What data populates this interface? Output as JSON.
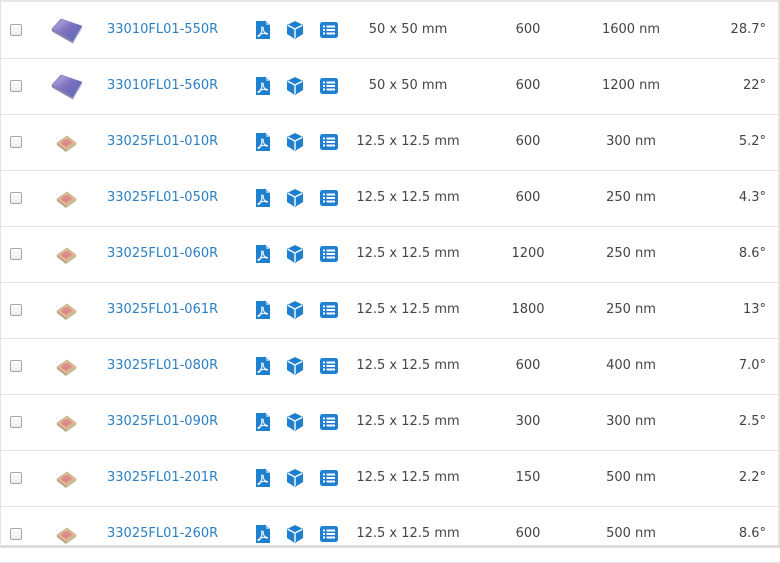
{
  "table": {
    "rows": [
      {
        "part": "33010FL01-550R",
        "size": "50 x 50 mm",
        "lines": "600",
        "wavelength": "1600 nm",
        "angle": "28.7°",
        "thumb": "large-grating"
      },
      {
        "part": "33010FL01-560R",
        "size": "50 x 50 mm",
        "lines": "600",
        "wavelength": "1200 nm",
        "angle": "22°",
        "thumb": "large-grating"
      },
      {
        "part": "33025FL01-010R",
        "size": "12.5 x 12.5 mm",
        "lines": "600",
        "wavelength": "300 nm",
        "angle": "5.2°",
        "thumb": "small-grating"
      },
      {
        "part": "33025FL01-050R",
        "size": "12.5 x 12.5 mm",
        "lines": "600",
        "wavelength": "250 nm",
        "angle": "4.3°",
        "thumb": "small-grating"
      },
      {
        "part": "33025FL01-060R",
        "size": "12.5 x 12.5 mm",
        "lines": "1200",
        "wavelength": "250 nm",
        "angle": "8.6°",
        "thumb": "small-grating"
      },
      {
        "part": "33025FL01-061R",
        "size": "12.5 x 12.5 mm",
        "lines": "1800",
        "wavelength": "250 nm",
        "angle": "13°",
        "thumb": "small-grating"
      },
      {
        "part": "33025FL01-080R",
        "size": "12.5 x 12.5 mm",
        "lines": "600",
        "wavelength": "400 nm",
        "angle": "7.0°",
        "thumb": "small-grating"
      },
      {
        "part": "33025FL01-090R",
        "size": "12.5 x 12.5 mm",
        "lines": "300",
        "wavelength": "300 nm",
        "angle": "2.5°",
        "thumb": "small-grating"
      },
      {
        "part": "33025FL01-201R",
        "size": "12.5 x 12.5 mm",
        "lines": "150",
        "wavelength": "500 nm",
        "angle": "2.2°",
        "thumb": "small-grating"
      },
      {
        "part": "33025FL01-260R",
        "size": "12.5 x 12.5 mm",
        "lines": "600",
        "wavelength": "500 nm",
        "angle": "8.6°",
        "thumb": "small-grating"
      }
    ]
  },
  "icons": {
    "datasheet": "pdf-icon",
    "model": "cube-icon",
    "specs": "list-icon"
  },
  "colors": {
    "link": "#2b7fc5",
    "icon": "#1f7fd0",
    "border": "#e3e3e3",
    "text": "#444444"
  }
}
